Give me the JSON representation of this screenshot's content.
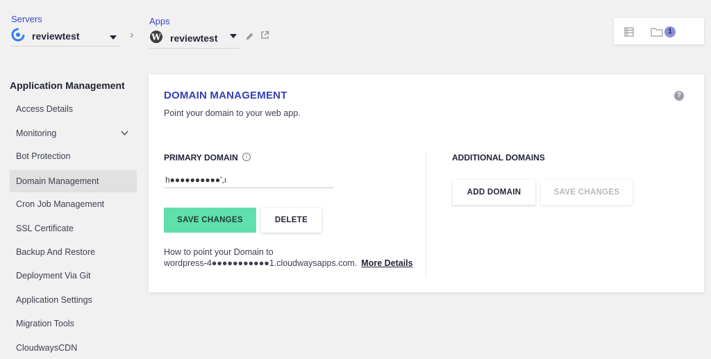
{
  "breadcrumb": {
    "servers_label": "Servers",
    "server_name": "reviewtest",
    "apps_label": "Apps",
    "app_name": "reviewtest",
    "notification_count": "1"
  },
  "sidebar": {
    "title": "Application Management",
    "items": [
      {
        "label": "Access Details"
      },
      {
        "label": "Monitoring"
      },
      {
        "label": "Bot Protection"
      },
      {
        "label": "Domain Management"
      },
      {
        "label": "Cron Job Management"
      },
      {
        "label": "SSL Certificate"
      },
      {
        "label": "Backup And Restore"
      },
      {
        "label": "Deployment Via Git"
      },
      {
        "label": "Application Settings"
      },
      {
        "label": "Migration Tools"
      },
      {
        "label": "CloudwaysCDN"
      }
    ]
  },
  "domain": {
    "title": "DOMAIN MANAGEMENT",
    "subtitle": "Point your domain to your web app.",
    "primary_label": "PRIMARY DOMAIN",
    "primary_value": "h●●●●●●●●●●',ı",
    "save_label": "SAVE CHANGES",
    "delete_label": "DELETE",
    "howto_line1": "How to point your Domain to",
    "howto_line2": "wordpress-4●●●●●●●●●●●1.cloudwaysapps.com.",
    "more_details": "More Details",
    "additional_label": "ADDITIONAL DOMAINS",
    "add_domain_label": "ADD DOMAIN",
    "save_changes_disabled": "SAVE CHANGES"
  },
  "colors": {
    "accent": "#3340b6",
    "green": "#5fe0ad",
    "active_bg": "#e1e1e1"
  }
}
